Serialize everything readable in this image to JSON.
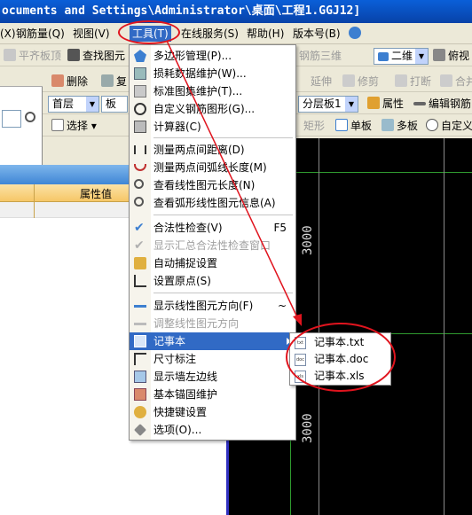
{
  "window": {
    "title": "ocuments and Settings\\Administrator\\桌面\\工程1.GGJ12]"
  },
  "menubar": {
    "items": [
      {
        "label": "(X)"
      },
      {
        "label": "钢筋量(Q)"
      },
      {
        "label": "视图(V)"
      },
      {
        "label": "工具(T)"
      },
      {
        "label": "在线服务(S)"
      },
      {
        "label": "帮助(H)"
      },
      {
        "label": "版本号(B)"
      }
    ]
  },
  "toolbar1": {
    "flat_slab": "平齐板顶",
    "find_element": "查找图元",
    "rebar_3d": "钢筋三维",
    "view_2d": "二维",
    "view_mode": "俯视"
  },
  "toolbar2": {
    "delete": "删除",
    "copy": "复",
    "extend": "延伸",
    "trim": "修剪",
    "break": "打断",
    "merge": "合并"
  },
  "toolbar3": {
    "floor": "首层",
    "type": "板",
    "layer": "分层板1",
    "properties": "属性",
    "edit_rebar": "编辑钢筋"
  },
  "toolbar4": {
    "select": "选择",
    "rect": "矩形",
    "single_slab": "单板",
    "multi_slab": "多板",
    "custom": "自定义"
  },
  "property_panel": {
    "header": "属性值"
  },
  "canvas": {
    "dim_top": "3000",
    "dim_bottom": "3000"
  },
  "tools_menu": {
    "items": [
      {
        "label": "多边形管理(P)...",
        "icon": "polygon-icon",
        "state": "normal"
      },
      {
        "label": "损耗数据维护(W)...",
        "icon": "table-icon",
        "state": "normal"
      },
      {
        "label": "标准图集维护(T)...",
        "icon": "atlas-icon",
        "state": "normal"
      },
      {
        "label": "自定义钢筋图形(G)...",
        "icon": "rebar-shape-icon",
        "state": "normal"
      },
      {
        "label": "计算器(C)",
        "icon": "calculator-icon",
        "state": "normal"
      },
      {
        "label": "测量两点间距离(D)",
        "icon": "measure-distance-icon",
        "state": "normal"
      },
      {
        "label": "测量两点间弧线长度(M)",
        "icon": "measure-arc-icon",
        "state": "normal"
      },
      {
        "label": "查看线性图元长度(N)",
        "icon": "linear-length-icon",
        "state": "normal"
      },
      {
        "label": "查看弧形线性图元信息(A)",
        "icon": "arc-info-icon",
        "state": "normal"
      },
      {
        "label": "合法性检查(V)",
        "icon": "check-icon",
        "shortcut": "F5",
        "state": "normal"
      },
      {
        "label": "显示汇总合法性检查窗口",
        "icon": "check-window-icon",
        "state": "disabled"
      },
      {
        "label": "自动捕捉设置",
        "icon": "snap-icon",
        "state": "normal"
      },
      {
        "label": "设置原点(S)",
        "icon": "origin-icon",
        "state": "normal"
      },
      {
        "label": "显示线性图元方向(F)",
        "icon": "direction-icon",
        "shortcut": "~",
        "state": "normal"
      },
      {
        "label": "调整线性图元方向",
        "icon": "adjust-direction-icon",
        "state": "disabled"
      },
      {
        "label": "记事本",
        "icon": "notepad-icon",
        "state": "highlighted"
      },
      {
        "label": "尺寸标注",
        "icon": "dimension-icon",
        "state": "normal"
      },
      {
        "label": "显示墙左边线",
        "icon": "wall-edge-icon",
        "state": "normal"
      },
      {
        "label": "基本锚固维护",
        "icon": "anchorage-icon",
        "state": "normal"
      },
      {
        "label": "快捷键设置",
        "icon": "hotkey-icon",
        "state": "normal"
      },
      {
        "label": "选项(O)...",
        "icon": "options-icon",
        "state": "normal"
      }
    ]
  },
  "notepad_submenu": {
    "items": [
      {
        "label": "记事本.txt",
        "tag": "txt"
      },
      {
        "label": "记事本.doc",
        "tag": "doc"
      },
      {
        "label": "记事本.xls",
        "tag": "xls"
      }
    ]
  },
  "colors": {
    "highlight": "#316AC5",
    "annotation": "#E0141E",
    "canvas": "#000000"
  }
}
